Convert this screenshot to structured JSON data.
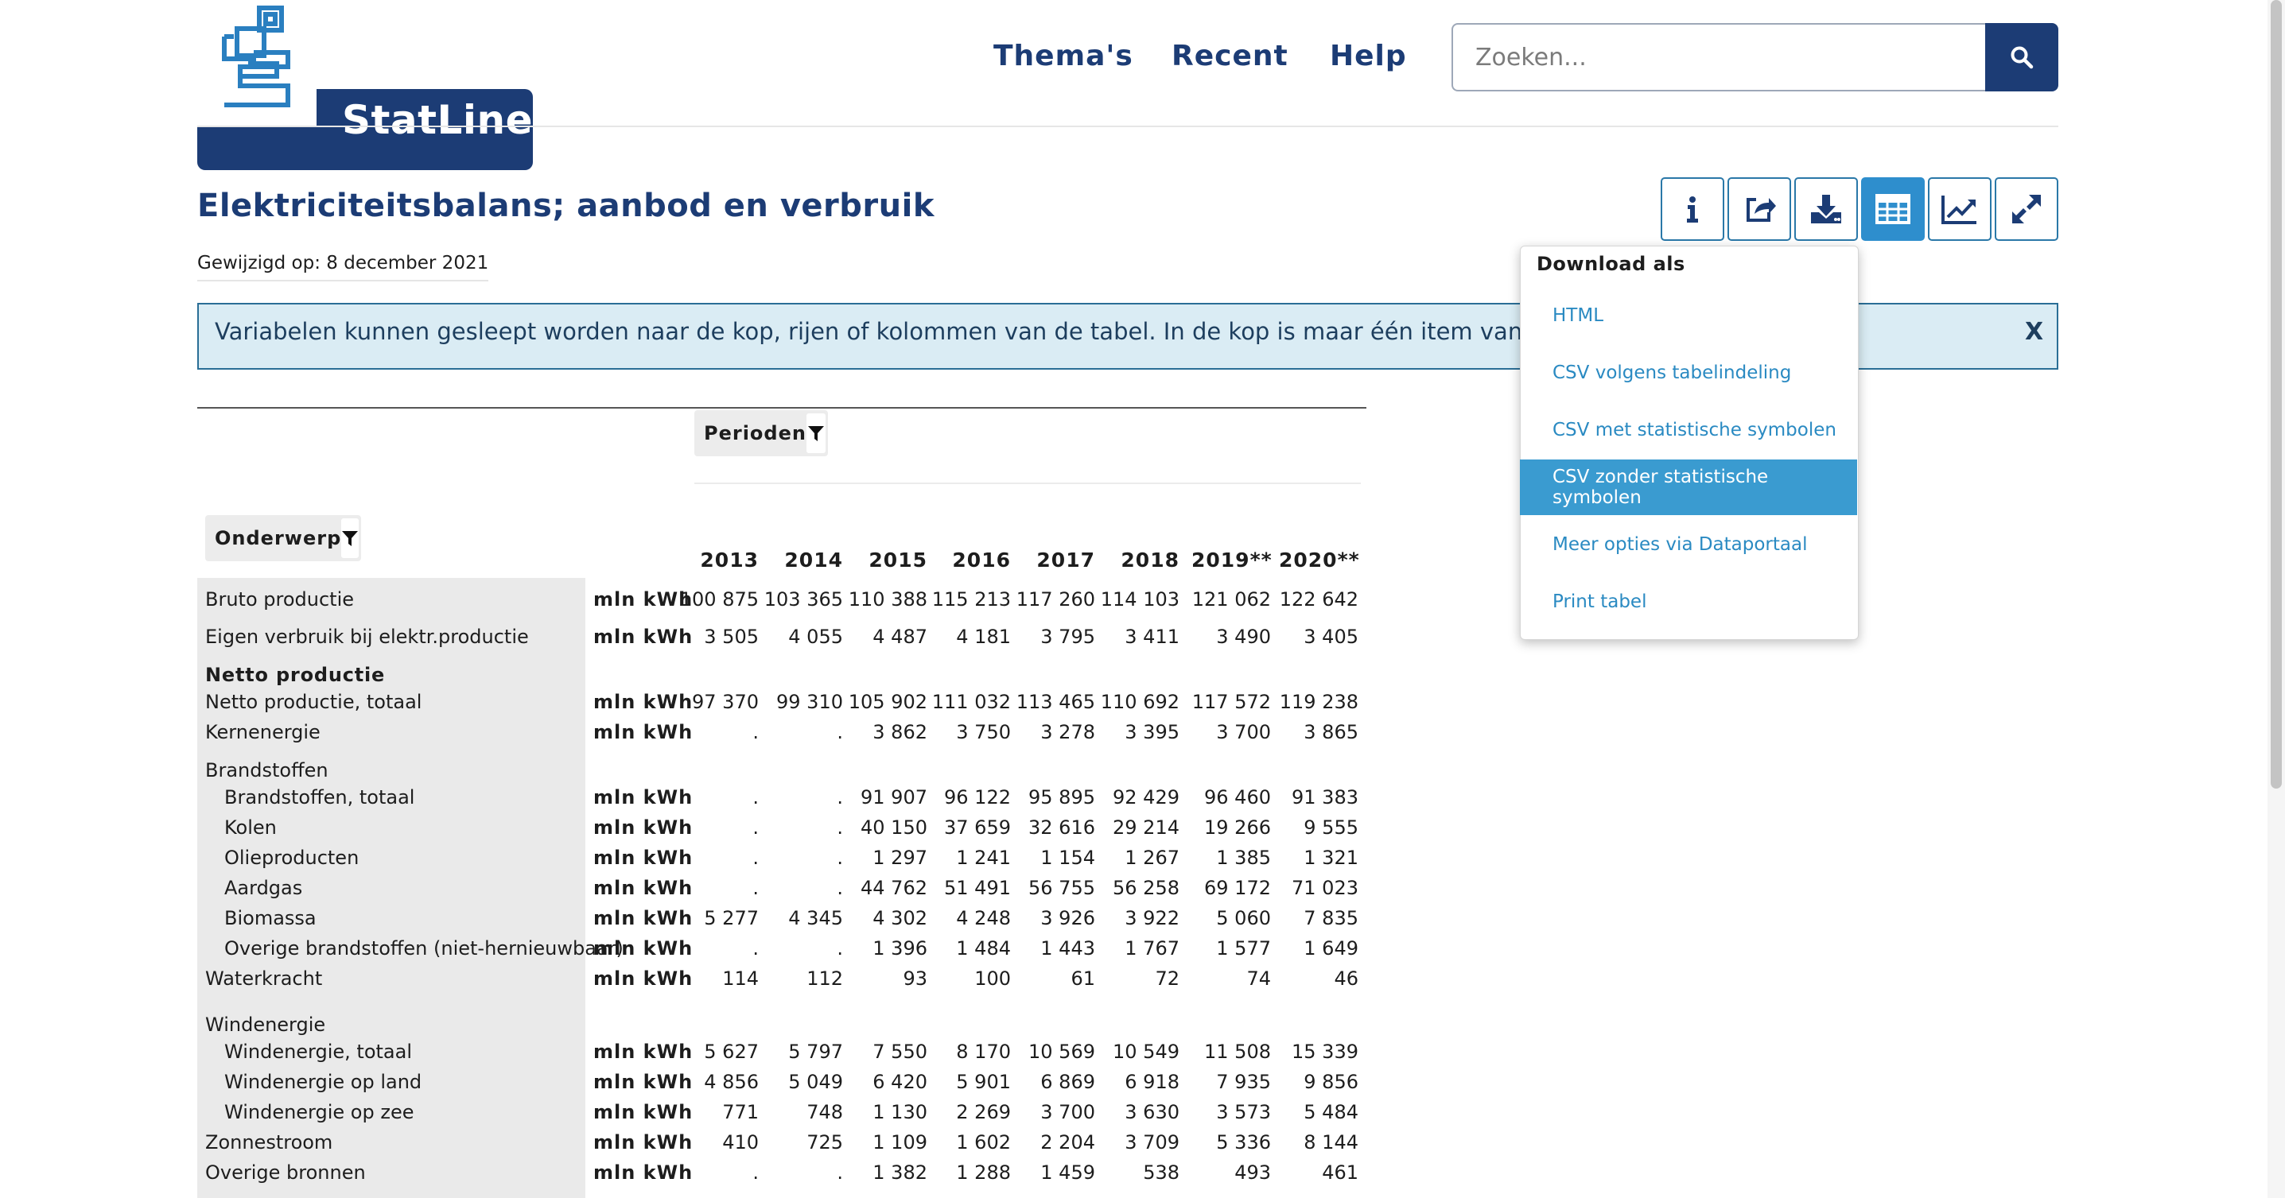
{
  "header": {
    "brand": "StatLine",
    "nav": [
      "Thema's",
      "Recent",
      "Help"
    ],
    "search_placeholder": "Zoeken..."
  },
  "colors": {
    "primary": "#1c3c75",
    "accent": "#2e8ecd",
    "info_bg": "#daecf4",
    "menu_selected": "#3a9bd0"
  },
  "page": {
    "title": "Elektriciteitsbalans; aanbod en verbruik",
    "modified": "Gewijzigd op: 8 december 2021"
  },
  "toolbar": {
    "buttons": [
      "info-icon",
      "share-icon",
      "download-icon",
      "table-icon",
      "chart-icon",
      "expand-icon"
    ],
    "active": "table-icon"
  },
  "info_bar": {
    "text": "Variabelen kunnen gesleept worden naar de kop, rijen of kolommen van de tabel. In de kop is maar één item van een variabele te selec",
    "close": "X"
  },
  "download_menu": {
    "heading": "Download als",
    "items": [
      "HTML",
      "CSV volgens tabelindeling",
      "CSV met statistische symbolen",
      "CSV zonder statistische symbolen",
      "Meer opties via Dataportaal",
      "Print tabel"
    ],
    "selected": "CSV zonder statistische symbolen"
  },
  "table": {
    "periods_label": "Perioden",
    "subject_label": "Onderwerp",
    "years": [
      "2013",
      "2014",
      "2015",
      "2016",
      "2017",
      "2018",
      "2019**",
      "2020**"
    ],
    "rows": [
      {
        "label": "Bruto productie",
        "unit": "mln kWh",
        "values": [
          "100 875",
          "103 365",
          "110 388",
          "115 213",
          "117 260",
          "114 103",
          "121 062",
          "122 642"
        ]
      },
      {
        "label": "Eigen verbruik bij elektr.productie",
        "unit": "mln kWh",
        "values": [
          "3 505",
          "4 055",
          "4 487",
          "4 181",
          "3 795",
          "3 411",
          "3 490",
          "3 405"
        ]
      },
      {
        "label": "Netto productie",
        "group": true
      },
      {
        "label": "Netto productie, totaal",
        "unit": "mln kWh",
        "values": [
          "97 370",
          "99 310",
          "105 902",
          "111 032",
          "113 465",
          "110 692",
          "117 572",
          "119 238"
        ]
      },
      {
        "label": "Kernenergie",
        "unit": "mln kWh",
        "values": [
          ".",
          ".",
          "3 862",
          "3 750",
          "3 278",
          "3 395",
          "3 700",
          "3 865"
        ]
      },
      {
        "label": "Brandstoffen",
        "subgroup": true
      },
      {
        "label": "Brandstoffen, totaal",
        "indent": true,
        "unit": "mln kWh",
        "values": [
          ".",
          ".",
          "91 907",
          "96 122",
          "95 895",
          "92 429",
          "96 460",
          "91 383"
        ]
      },
      {
        "label": "Kolen",
        "indent": true,
        "unit": "mln kWh",
        "values": [
          ".",
          ".",
          "40 150",
          "37 659",
          "32 616",
          "29 214",
          "19 266",
          "9 555"
        ]
      },
      {
        "label": "Olieproducten",
        "indent": true,
        "unit": "mln kWh",
        "values": [
          ".",
          ".",
          "1 297",
          "1 241",
          "1 154",
          "1 267",
          "1 385",
          "1 321"
        ]
      },
      {
        "label": "Aardgas",
        "indent": true,
        "unit": "mln kWh",
        "values": [
          ".",
          ".",
          "44 762",
          "51 491",
          "56 755",
          "56 258",
          "69 172",
          "71 023"
        ]
      },
      {
        "label": "Biomassa",
        "indent": true,
        "unit": "mln kWh",
        "values": [
          "5 277",
          "4 345",
          "4 302",
          "4 248",
          "3 926",
          "3 922",
          "5 060",
          "7 835"
        ]
      },
      {
        "label": "Overige brandstoffen (niet-hernieuwbaar)",
        "indent": true,
        "unit": "mln kWh",
        "values": [
          ".",
          ".",
          "1 396",
          "1 484",
          "1 443",
          "1 767",
          "1 577",
          "1 649"
        ]
      },
      {
        "label": "Waterkracht",
        "unit": "mln kWh",
        "values": [
          "114",
          "112",
          "93",
          "100",
          "61",
          "72",
          "74",
          "46"
        ]
      },
      {
        "label": "Windenergie",
        "subgroup": true
      },
      {
        "label": "Windenergie, totaal",
        "indent": true,
        "unit": "mln kWh",
        "values": [
          "5 627",
          "5 797",
          "7 550",
          "8 170",
          "10 569",
          "10 549",
          "11 508",
          "15 339"
        ]
      },
      {
        "label": "Windenergie op land",
        "indent": true,
        "unit": "mln kWh",
        "values": [
          "4 856",
          "5 049",
          "6 420",
          "5 901",
          "6 869",
          "6 918",
          "7 935",
          "9 856"
        ]
      },
      {
        "label": "Windenergie op zee",
        "indent": true,
        "unit": "mln kWh",
        "values": [
          "771",
          "748",
          "1 130",
          "2 269",
          "3 700",
          "3 630",
          "3 573",
          "5 484"
        ]
      },
      {
        "label": "Zonnestroom",
        "unit": "mln kWh",
        "values": [
          "410",
          "725",
          "1 109",
          "1 602",
          "2 204",
          "3 709",
          "5 336",
          "8 144"
        ]
      },
      {
        "label": "Overige bronnen",
        "unit": "mln kWh",
        "values": [
          ".",
          ".",
          "1 382",
          "1 288",
          "1 459",
          "538",
          "493",
          "461"
        ]
      }
    ]
  }
}
